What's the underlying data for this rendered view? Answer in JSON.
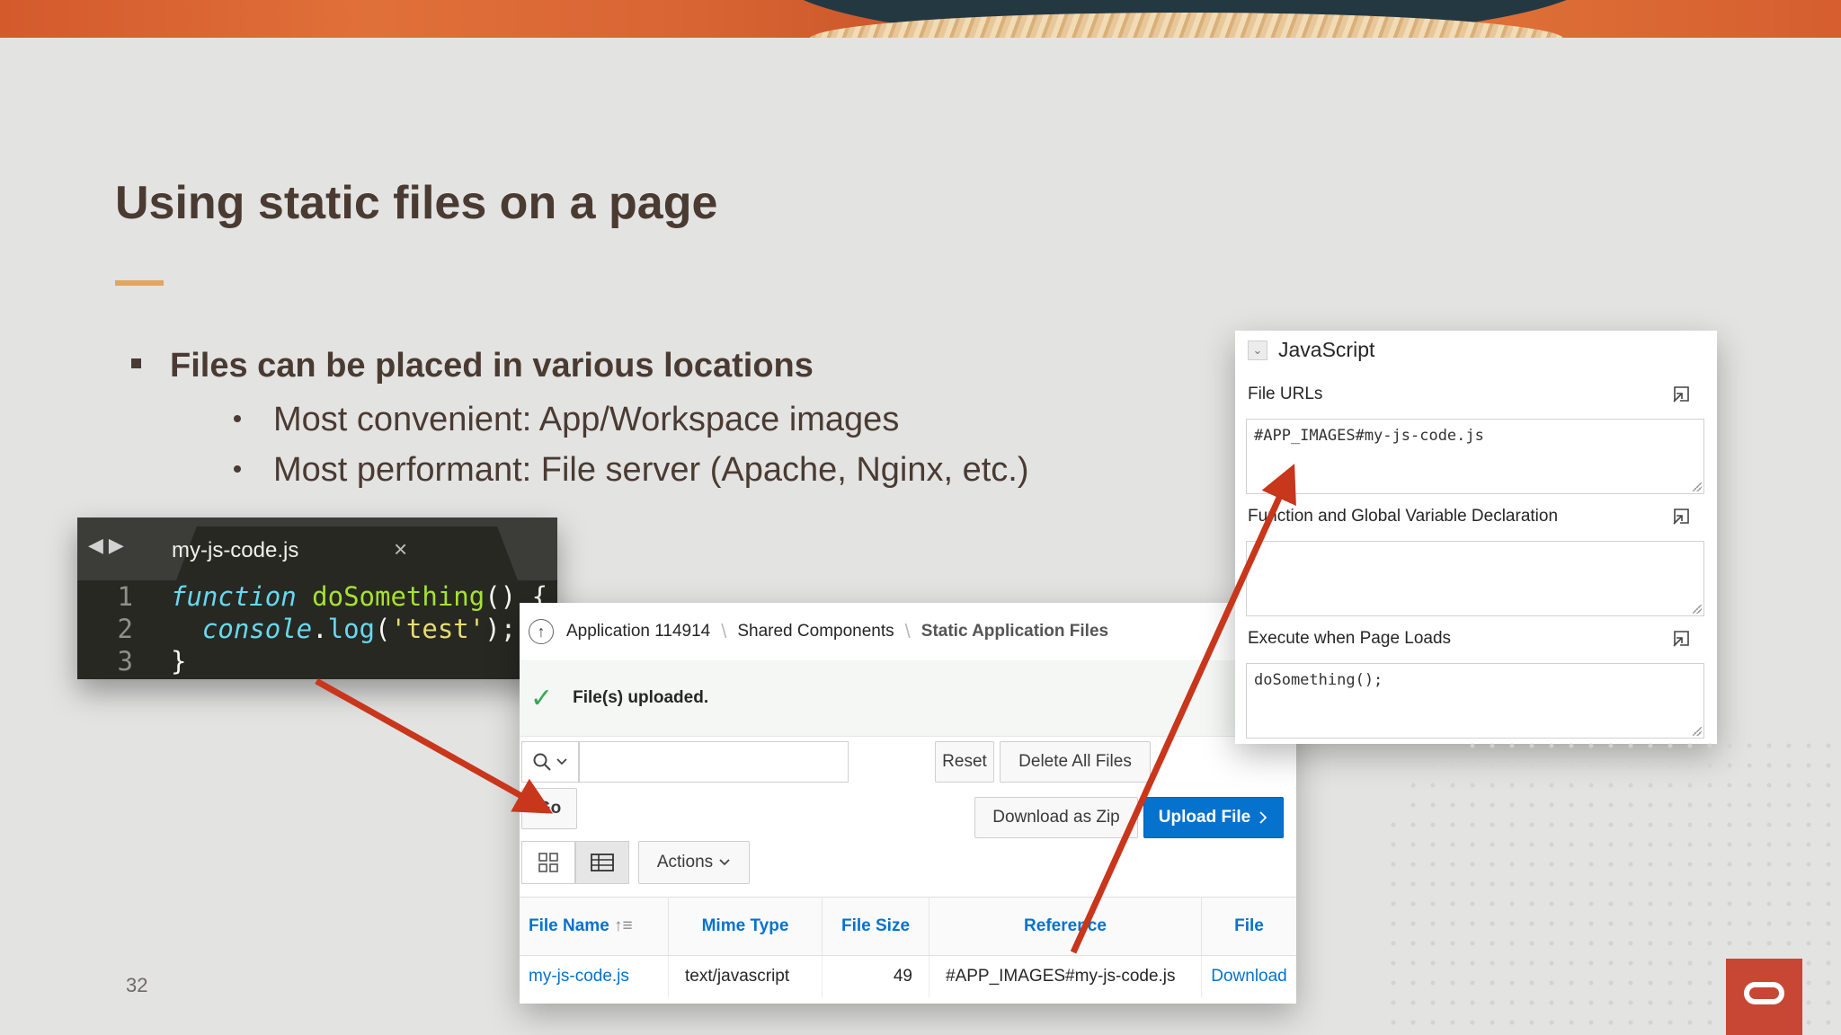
{
  "slide": {
    "title": "Using static files on a page",
    "bullet_main": "Files can be placed in various locations",
    "bullets_sub": [
      "Most convenient: App/Workspace images",
      "Most performant: File server (Apache, Nginx, etc.)"
    ],
    "page_number": "32"
  },
  "editor": {
    "tab_name": "my-js-code.js",
    "close_glyph": "×",
    "line_numbers": [
      "1",
      "2",
      "3"
    ],
    "line1": {
      "keyword": "function",
      "name": "doSomething",
      "rest": "() {"
    },
    "line2": {
      "object": "console",
      "dot": ".",
      "method": "log",
      "open": "(",
      "string": "'test'",
      "close": ");"
    },
    "line3": "}"
  },
  "apex": {
    "breadcrumb": {
      "up_glyph": "↑",
      "items": [
        "Application 114914",
        "Shared Components",
        "Static Application Files"
      ],
      "separator": "\\"
    },
    "success_icon": "check-icon",
    "success_message": "File(s) uploaded.",
    "search_placeholder": "",
    "buttons": {
      "reset": "Reset",
      "delete_all": "Delete All Files",
      "go": "Go",
      "download_zip": "Download as Zip",
      "upload": "Upload File",
      "actions": "Actions"
    },
    "table": {
      "columns": [
        "File Name",
        "Mime Type",
        "File Size",
        "Reference",
        "File"
      ],
      "sort_glyph": "↑≡",
      "rows": [
        [
          "my-js-code.js",
          "text/javascript",
          "49",
          "#APP_IMAGES#my-js-code.js",
          "Download"
        ]
      ]
    }
  },
  "js_panel": {
    "title": "JavaScript",
    "fields": [
      {
        "label": "File URLs",
        "value": "#APP_IMAGES#my-js-code.js"
      },
      {
        "label": "Function and Global Variable Declaration",
        "value": ""
      },
      {
        "label": "Execute when Page Loads",
        "value": "doSomething();"
      }
    ]
  },
  "colors": {
    "accent_blue": "#0572ce",
    "arrow_red": "#c8361c",
    "oracle_red": "#c74634",
    "title_brown": "#4a3b32"
  }
}
